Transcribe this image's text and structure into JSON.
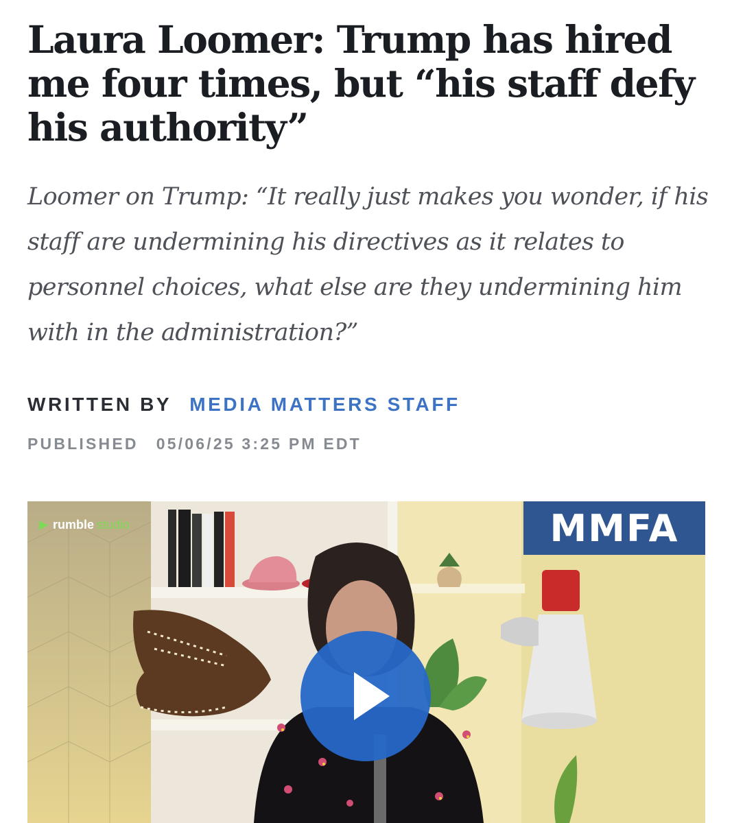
{
  "article": {
    "headline": "Laura Loomer: Trump has hired me four times, but “his staff defy his authority”",
    "dek": "Loomer on Trump: “It really just makes you wonder, if his staff are undermining his directives as it relates to personnel choices, what else are they undermining him with in the administration?”",
    "written_by_label": "WRITTEN BY",
    "author": "MEDIA MATTERS STAFF",
    "published_label": "PUBLISHED",
    "published_date": "05/06/25 3:25 PM EDT"
  },
  "video": {
    "brand_name": "rumble",
    "brand_suffix": "studio",
    "badge": "MMFA",
    "play_icon": "play-icon",
    "colors": {
      "badge_bg": "#2f5690",
      "play_bg": "#2668c8",
      "brand_green": "#7ed957"
    }
  },
  "theme": {
    "headline_color": "#1a1d22",
    "dek_color": "#4e5157",
    "author_color": "#3d73c4",
    "meta_gray": "#868a91"
  }
}
